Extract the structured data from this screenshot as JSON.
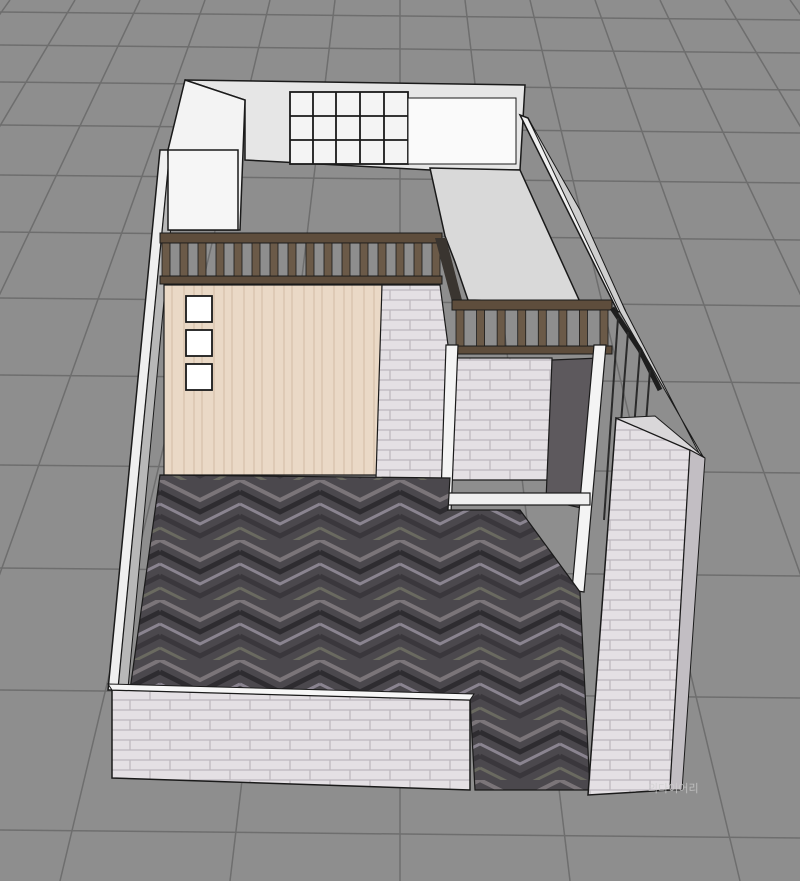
{
  "viewport": {
    "background": "#8e8e8e",
    "grid_line_color": "#6e6e6e"
  },
  "colors": {
    "wall_white": "#f2f2f2",
    "wall_shade": "#d6d6d6",
    "counter_top": "#dcdcdc",
    "outline": "#1a1a1a",
    "wood_panel": "#e8d9c8",
    "wood_grain": "#cdb8a2",
    "brick": "#e2dee2",
    "brick_mortar": "#bdb8be",
    "floor_dark": "#4a474c",
    "floor_light": "#7a7578",
    "railing": "#6b5a48",
    "railing_cap": "#3a3530"
  },
  "model": {
    "floor_pattern": "herringbone",
    "railing_post_count_back": 16,
    "railing_post_count_right": 8,
    "window_count": 3
  },
  "watermark": {
    "text": "의다이어리"
  }
}
